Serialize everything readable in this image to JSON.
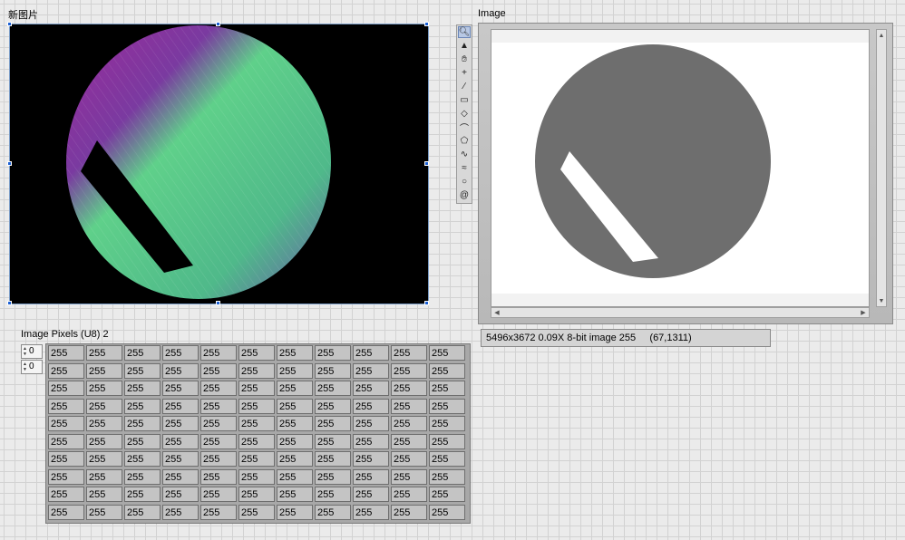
{
  "new_picture": {
    "label": "新图片"
  },
  "image_display": {
    "label": "Image",
    "status": "5496x3672 0.09X 8-bit image 255     (67,1311)"
  },
  "tools": [
    "zoom-icon",
    "pan-hand-icon",
    "pointer-icon",
    "point-crosshair-icon",
    "line-icon",
    "rectangle-icon",
    "rotated-rectangle-icon",
    "annulus-icon",
    "polygon-icon",
    "freehand-icon",
    "broken-line-icon",
    "oval-icon",
    "spiral-icon"
  ],
  "array": {
    "label": "Image Pixels (U8) 2",
    "index_row": "0",
    "index_col": "0",
    "rows": [
      [
        "255",
        "255",
        "255",
        "255",
        "255",
        "255",
        "255",
        "255",
        "255",
        "255",
        "255"
      ],
      [
        "255",
        "255",
        "255",
        "255",
        "255",
        "255",
        "255",
        "255",
        "255",
        "255",
        "255"
      ],
      [
        "255",
        "255",
        "255",
        "255",
        "255",
        "255",
        "255",
        "255",
        "255",
        "255",
        "255"
      ],
      [
        "255",
        "255",
        "255",
        "255",
        "255",
        "255",
        "255",
        "255",
        "255",
        "255",
        "255"
      ],
      [
        "255",
        "255",
        "255",
        "255",
        "255",
        "255",
        "255",
        "255",
        "255",
        "255",
        "255"
      ],
      [
        "255",
        "255",
        "255",
        "255",
        "255",
        "255",
        "255",
        "255",
        "255",
        "255",
        "255"
      ],
      [
        "255",
        "255",
        "255",
        "255",
        "255",
        "255",
        "255",
        "255",
        "255",
        "255",
        "255"
      ],
      [
        "255",
        "255",
        "255",
        "255",
        "255",
        "255",
        "255",
        "255",
        "255",
        "255",
        "255"
      ],
      [
        "255",
        "255",
        "255",
        "255",
        "255",
        "255",
        "255",
        "255",
        "255",
        "255",
        "255"
      ],
      [
        "255",
        "255",
        "255",
        "255",
        "255",
        "255",
        "255",
        "255",
        "255",
        "255",
        "255"
      ]
    ]
  },
  "colors": {
    "accent_handle": "#1a5fd4",
    "metal_green": "#5fd08a",
    "metal_purple": "#9a2a9a"
  }
}
